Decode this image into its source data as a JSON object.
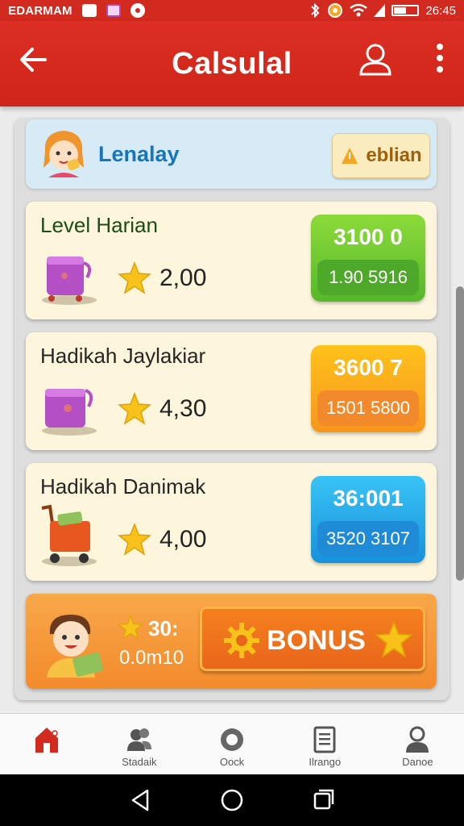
{
  "status_bar": {
    "app_name": "EDARMAM",
    "time": "26:45",
    "battery_level": 0.5
  },
  "app_bar": {
    "title": "Calsulal",
    "back_icon": "arrow-left-icon",
    "user_icon": "user-icon",
    "more_icon": "more-vert-icon"
  },
  "profile": {
    "name": "Lenalay",
    "button_label": "eblian",
    "button_icon": "warning-icon"
  },
  "levels": [
    {
      "title": "Level Harian",
      "value": "2,00",
      "price_top": "3100 0",
      "price_bottom": "1.90 5916",
      "color": "#56b72b"
    },
    {
      "title": "Hadikah Jaylakiar",
      "value": "4,30",
      "price_top": "3600 7",
      "price_bottom": "1501 5800",
      "color": "#f7961c"
    },
    {
      "title": "Hadikah Danimak",
      "value": "4,00",
      "price_top": "36:001",
      "price_bottom": "3520 3107",
      "color": "#1791dc"
    }
  ],
  "bonus": {
    "count": "30:",
    "sub": "0.0m10",
    "button_label": "BONUS"
  },
  "bottom_nav": [
    {
      "label": "",
      "icon": "home-icon",
      "active": true
    },
    {
      "label": "Stadaik",
      "icon": "people-icon"
    },
    {
      "label": "Oock",
      "icon": "circle-icon"
    },
    {
      "label": "Ilrango",
      "icon": "document-icon"
    },
    {
      "label": "Danoe",
      "icon": "person-icon"
    }
  ],
  "colors": {
    "primary_red": "#d32a20",
    "accent_blue": "#1775b9",
    "bonus_orange": "#f38b2b"
  }
}
